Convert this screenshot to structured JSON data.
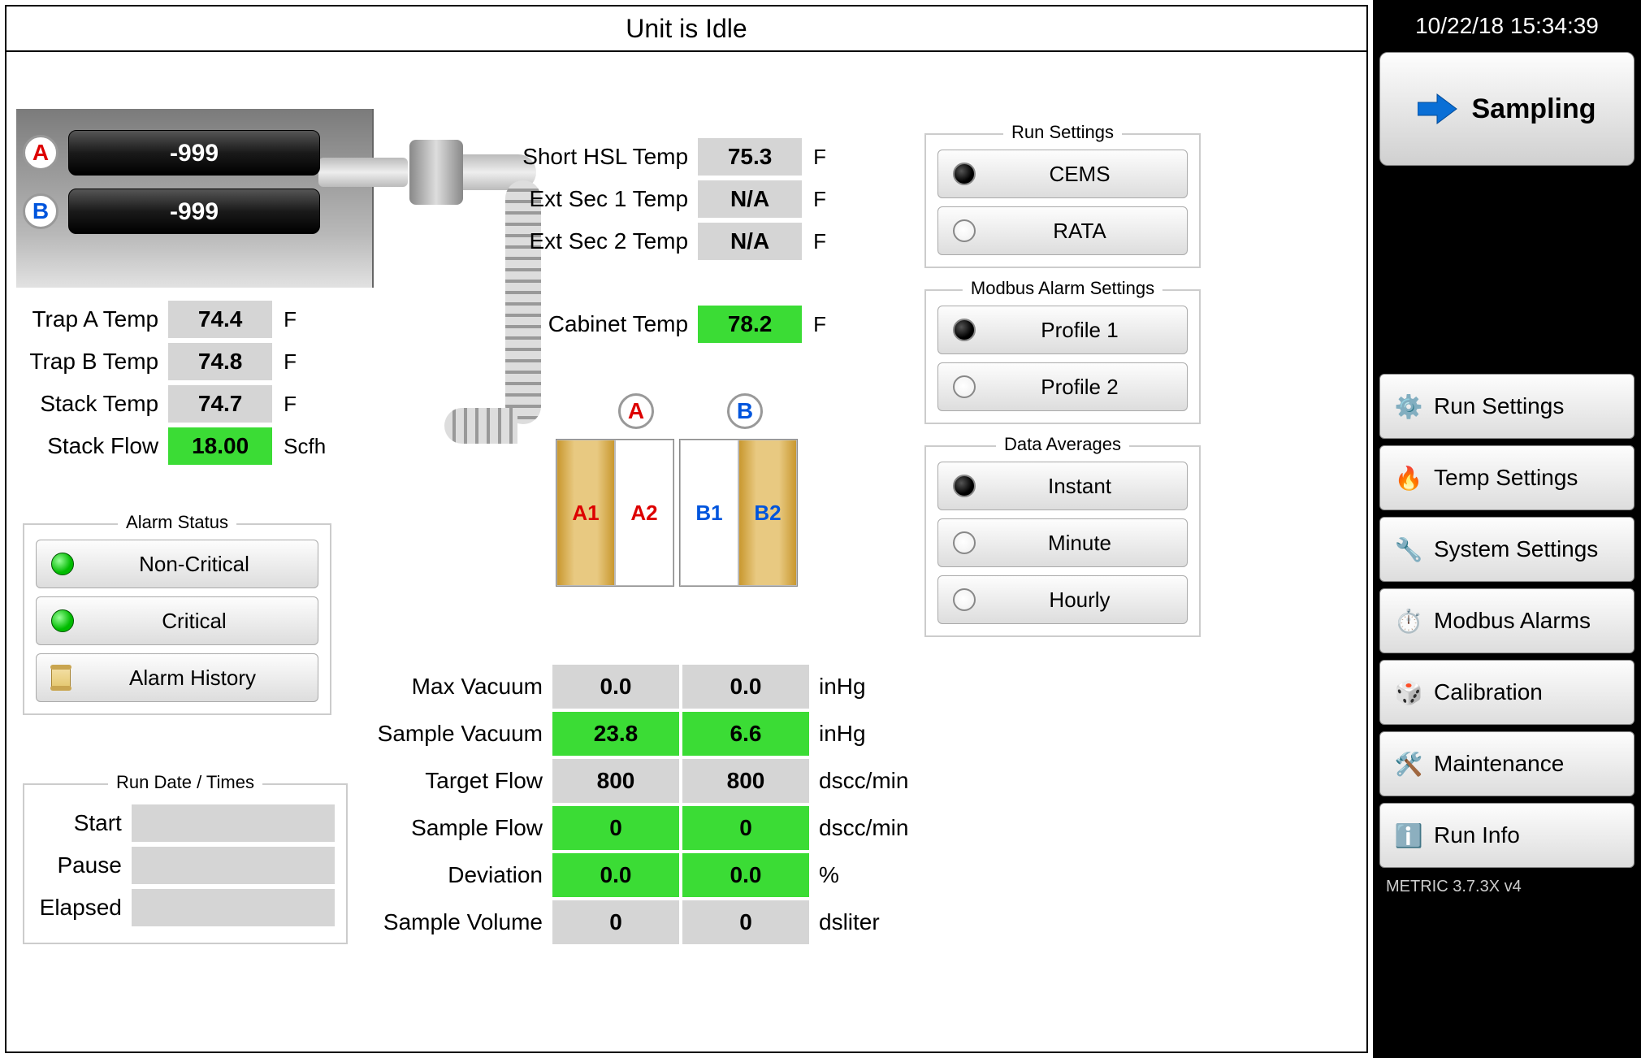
{
  "title": "Unit is Idle",
  "clock": "10/22/18 15:34:39",
  "version": "METRIC 3.7.3X v4",
  "gauges": {
    "a_value": "-999",
    "b_value": "-999"
  },
  "temps_left": {
    "trap_a": {
      "label": "Trap A Temp",
      "value": "74.4",
      "unit": "F"
    },
    "trap_b": {
      "label": "Trap B Temp",
      "value": "74.8",
      "unit": "F"
    },
    "stack_temp": {
      "label": "Stack Temp",
      "value": "74.7",
      "unit": "F"
    },
    "stack_flow": {
      "label": "Stack Flow",
      "value": "18.00",
      "unit": "Scfh",
      "green": true
    }
  },
  "temps_right": {
    "short_hsl": {
      "label": "Short HSL Temp",
      "value": "75.3",
      "unit": "F"
    },
    "ext1": {
      "label": "Ext Sec 1 Temp",
      "value": "N/A",
      "unit": "F"
    },
    "ext2": {
      "label": "Ext Sec 2 Temp",
      "value": "N/A",
      "unit": "F"
    },
    "cabinet": {
      "label": "Cabinet Temp",
      "value": "78.2",
      "unit": "F",
      "green": true
    }
  },
  "alarm_status": {
    "legend": "Alarm Status",
    "noncritical": "Non-Critical",
    "critical": "Critical",
    "history": "Alarm History"
  },
  "run_times": {
    "legend": "Run Date / Times",
    "start_label": "Start",
    "pause_label": "Pause",
    "elapsed_label": "Elapsed",
    "start": "",
    "pause": "",
    "elapsed": ""
  },
  "sample_cells": {
    "a1": "A1",
    "a2": "A2",
    "b1": "B1",
    "b2": "B2"
  },
  "data_rows": {
    "max_vac": {
      "label": "Max Vacuum",
      "a": "0.0",
      "b": "0.0",
      "unit": "inHg"
    },
    "samp_vac": {
      "label": "Sample Vacuum",
      "a": "23.8",
      "b": "6.6",
      "unit": "inHg",
      "green": true
    },
    "target": {
      "label": "Target Flow",
      "a": "800",
      "b": "800",
      "unit": "dscc/min"
    },
    "samp_flow": {
      "label": "Sample Flow",
      "a": "0",
      "b": "0",
      "unit": "dscc/min",
      "green": true
    },
    "dev": {
      "label": "Deviation",
      "a": "0.0",
      "b": "0.0",
      "unit": "%",
      "green": true
    },
    "vol": {
      "label": "Sample Volume",
      "a": "0",
      "b": "0",
      "unit": "dsliter"
    }
  },
  "run_settings": {
    "legend": "Run Settings",
    "cems": "CEMS",
    "rata": "RATA"
  },
  "modbus_alarm": {
    "legend": "Modbus Alarm Settings",
    "p1": "Profile 1",
    "p2": "Profile 2"
  },
  "data_avg": {
    "legend": "Data Averages",
    "instant": "Instant",
    "minute": "Minute",
    "hourly": "Hourly"
  },
  "big_tile": "Sampling",
  "nav": {
    "run_settings": "Run Settings",
    "temp_settings": "Temp Settings",
    "system_settings": "System Settings",
    "modbus_alarms": "Modbus Alarms",
    "calibration": "Calibration",
    "maintenance": "Maintenance",
    "run_info": "Run Info"
  }
}
